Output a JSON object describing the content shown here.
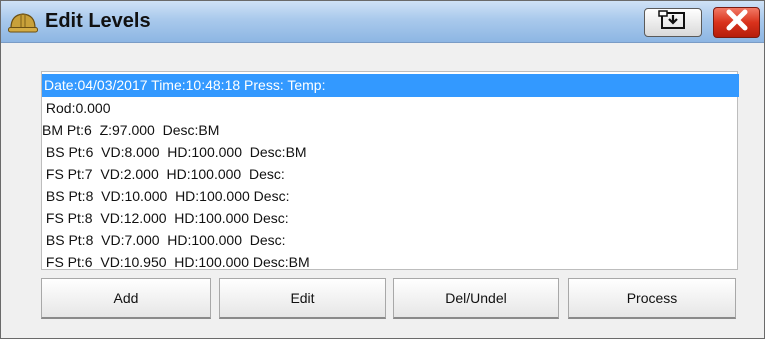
{
  "window": {
    "title": "Edit Levels",
    "icons": {
      "app": "hard-hat-icon",
      "save": "save-icon",
      "close": "close-icon"
    },
    "colors": {
      "titlebar": "#a9c9ec",
      "selection": "#3399ff",
      "close": "#d9321c"
    }
  },
  "list": {
    "rows": [
      {
        "text": "Date:04/03/2017 Time:10:48:18 Press: Temp:",
        "selected": true
      },
      {
        "text": " Rod:0.000",
        "selected": false
      },
      {
        "text": "BM Pt:6  Z:97.000  Desc:BM",
        "selected": false
      },
      {
        "text": " BS Pt:6  VD:8.000  HD:100.000  Desc:BM",
        "selected": false
      },
      {
        "text": " FS Pt:7  VD:2.000  HD:100.000  Desc:",
        "selected": false
      },
      {
        "text": " BS Pt:8  VD:10.000  HD:100.000 Desc:",
        "selected": false
      },
      {
        "text": " FS Pt:8  VD:12.000  HD:100.000 Desc:",
        "selected": false
      },
      {
        "text": " BS Pt:8  VD:7.000  HD:100.000  Desc:",
        "selected": false
      },
      {
        "text": " FS Pt:6  VD:10.950  HD:100.000 Desc:BM",
        "selected": false
      }
    ]
  },
  "buttons": {
    "add": "Add",
    "edit": "Edit",
    "del": "Del/Undel",
    "process": "Process"
  }
}
